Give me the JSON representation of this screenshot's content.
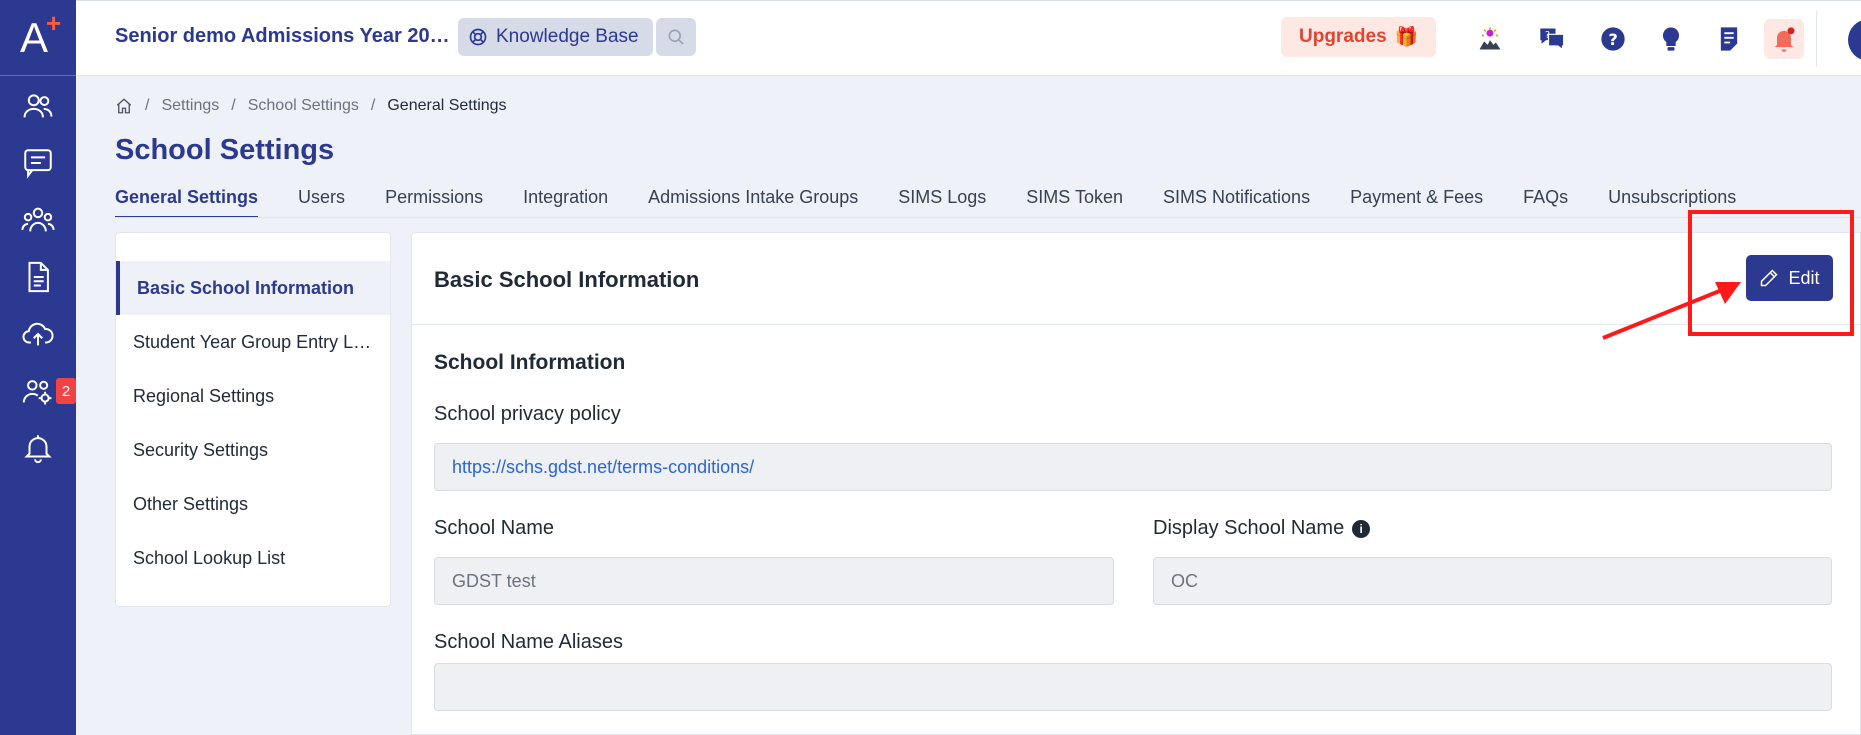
{
  "topbar": {
    "year_select": "Senior demo Admissions Year 20…",
    "knowledge_base": "Knowledge Base",
    "upgrades": "Upgrades",
    "upgrades_emoji": "🎁"
  },
  "rail": {
    "badge_count": "2"
  },
  "breadcrumb": {
    "items": [
      "Settings",
      "School Settings",
      "General Settings"
    ]
  },
  "page": {
    "title": "School Settings"
  },
  "tabs": [
    "General Settings",
    "Users",
    "Permissions",
    "Integration",
    "Admissions Intake Groups",
    "SIMS Logs",
    "SIMS Token",
    "SIMS Notifications",
    "Payment & Fees",
    "FAQs",
    "Unsubscriptions"
  ],
  "submenu": [
    "Basic School Information",
    "Student Year Group Entry L…",
    "Regional Settings",
    "Security Settings",
    "Other Settings",
    "School Lookup List"
  ],
  "card": {
    "title": "Basic School Information",
    "edit_label": "Edit",
    "section_title": "School Information",
    "privacy_label": "School privacy policy",
    "privacy_value": "https://schs.gdst.net/terms-conditions/",
    "school_name_label": "School Name",
    "school_name_value": "GDST test",
    "display_name_label": "Display School Name",
    "display_name_value": "OC",
    "aliases_label": "School Name Aliases",
    "aliases_value": ""
  },
  "colors": {
    "brand": "#2b3990",
    "accent": "#ff5a3c",
    "annotation": "#ff1a1a"
  }
}
